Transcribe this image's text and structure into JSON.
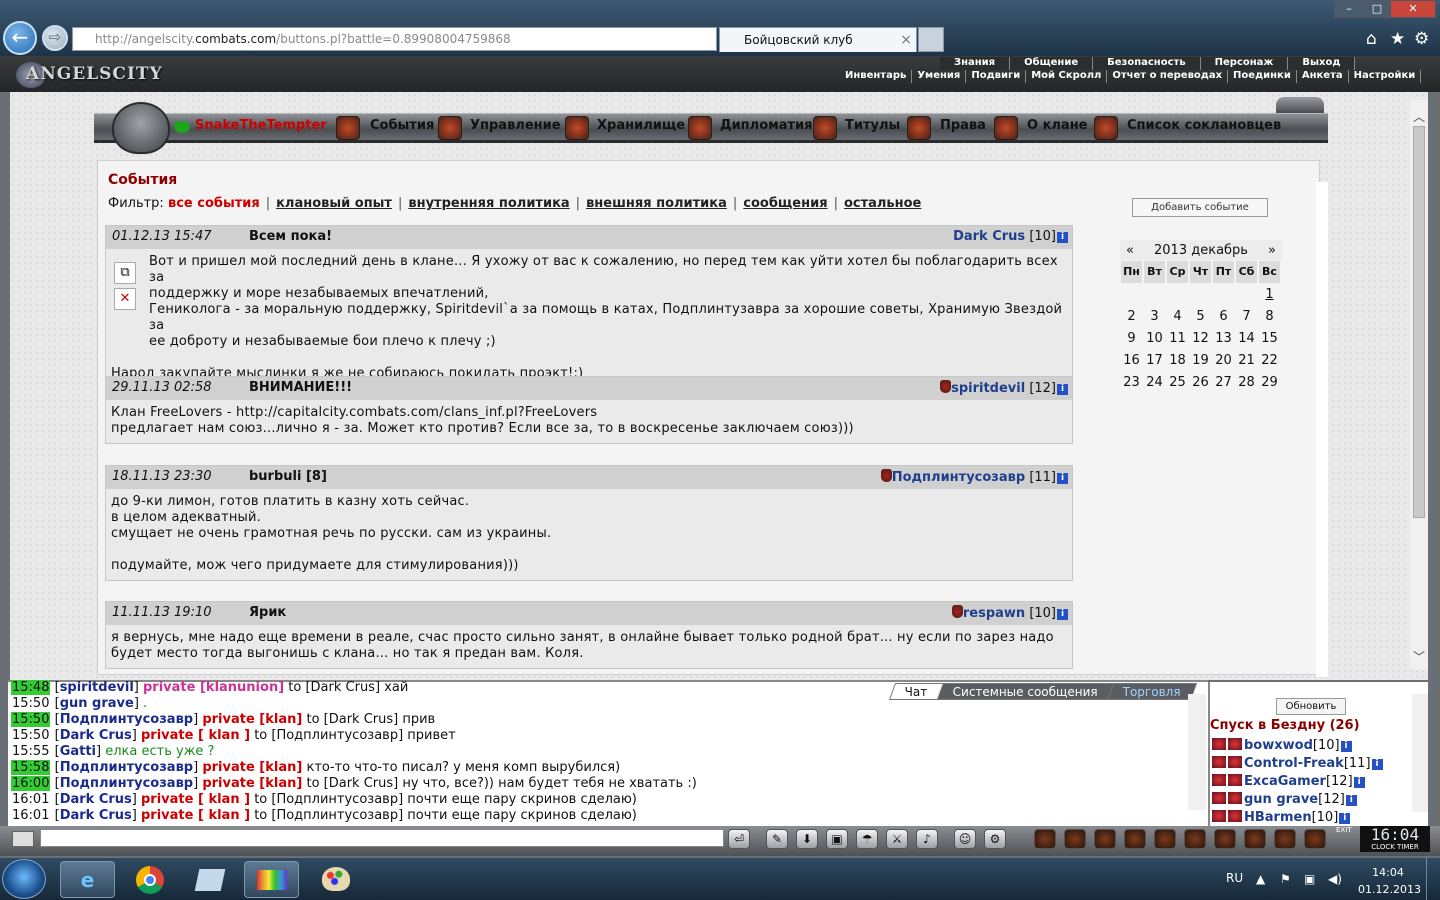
{
  "browser": {
    "url_prefix": "http://angelscity.",
    "url_domain": "combats.com",
    "url_suffix": "/buttons.pl?battle=0.89908004759868",
    "tab_title": "Бойцовский клуб",
    "tab_close": "×",
    "back_glyph": "←",
    "forward_glyph": "⇨",
    "win_min": "–",
    "win_max": "□",
    "win_close": "✕",
    "home_icon": "⌂",
    "star_icon": "★",
    "gear_icon": "⚙"
  },
  "header": {
    "logo": "ANGELSCITY",
    "menu_top": [
      "Знания",
      "Общение",
      "Безопасность",
      "Персонаж",
      "Выход"
    ],
    "menu_bottom": [
      "Инвентарь",
      "Умения",
      "Подвиги",
      "Мой Скролл",
      "Отчет о переводах",
      "Поединки",
      "Анкета",
      "Настройки"
    ]
  },
  "clan_toolbar": {
    "user": "SnakeTheTempter",
    "items": [
      "События",
      "Управление",
      "Хранилище",
      "Дипломатия",
      "Титулы",
      "Права",
      "О клане",
      "Список соклановцев"
    ]
  },
  "main": {
    "title": "События",
    "filter_label": "Фильтр:",
    "filters": [
      "все события",
      "клановый опыт",
      "внутренняя политика",
      "внешняя политика",
      "сообщения",
      "остальное"
    ],
    "add_event": "Добавить событие",
    "events": [
      {
        "date": "01.12.13 15:47",
        "title": "Всем пока!",
        "author": "Dark Crus",
        "level": "[10]",
        "lines": [
          "Вот и пришел мой последний день в клане... Я ухожу от вас к сожалению, но перед тем как уйти хотел бы поблагодарить всех за",
          "поддержку и море незабываемых впечатлений,",
          "Гениколога - за моральную поддержку, Spiritdevil`а за помощь в катах, Подплинтузавра за хорошие советы, Хранимую Звездой за",
          "ее доброту и незабываемые бои плечо к плечу ;)",
          "",
          "Народ закупайте мыслинки я же не собираюсь покидать проэкт!:)"
        ]
      },
      {
        "date": "29.11.13 02:58",
        "title": "ВНИМАНИЕ!!!",
        "author": "spiritdevil",
        "level": "[12]",
        "lines": [
          "Клан FreeLovers - http://capitalcity.combats.com/clans_inf.pl?FreeLovers",
          "предлагает нам союз...лично я - за. Может кто против? Если все за, то в воскресенье заключаем союз)))"
        ]
      },
      {
        "date": "18.11.13 23:30",
        "title": "burbuli [8]",
        "author": "Подплинтусозавр",
        "level": "[11]",
        "lines": [
          "до 9-ки лимон, готов платить в казну хоть сейчас.",
          "в целом адекватный.",
          "смущает не очень грамотная речь по русски. сам из украины.",
          "",
          "подумайте, мож чего придумаете для стимулирования)))"
        ]
      },
      {
        "date": "11.11.13 19:10",
        "title": "Ярик",
        "author": "respawn",
        "level": "[10]",
        "lines": [
          "я вернусь, мне надо еще времени в реале, счас просто сильно занят, в онлайне бывает только родной брат... ну если по зарез надо",
          "будет место тогда выгонишь с клана... но так я предан вам. Коля."
        ]
      }
    ],
    "calendar": {
      "prev": "«",
      "next": "»",
      "month": "2013 декабрь",
      "weekdays": [
        "Пн",
        "Вт",
        "Ср",
        "Чт",
        "Пт",
        "Сб",
        "Вс"
      ],
      "weeks": [
        [
          "",
          "",
          "",
          "",
          "",
          "",
          "1"
        ],
        [
          "2",
          "3",
          "4",
          "5",
          "6",
          "7",
          "8"
        ],
        [
          "9",
          "10",
          "11",
          "12",
          "13",
          "14",
          "15"
        ],
        [
          "16",
          "17",
          "18",
          "19",
          "20",
          "21",
          "22"
        ],
        [
          "23",
          "24",
          "25",
          "26",
          "27",
          "28",
          "29"
        ]
      ]
    }
  },
  "chat": {
    "tabs": [
      "Чат",
      "Системные сообщения",
      "Торговля"
    ],
    "lines": [
      {
        "time": "15:48",
        "hl": true,
        "nick": "spiritdevil",
        "priv": "private [klanunion]",
        "pcls": "pv2",
        "to": "to [Dark Crus]",
        "msg": "хай"
      },
      {
        "time": "15:50",
        "hl": false,
        "nick": "gun grave",
        "priv": "",
        "pcls": "pv",
        "to": "",
        "msg": "."
      },
      {
        "time": "15:50",
        "hl": true,
        "nick": "Подплинтусозавр",
        "priv": "private [klan]",
        "pcls": "pv",
        "to": "to [Dark Crus]",
        "msg": "прив"
      },
      {
        "time": "15:50",
        "hl": false,
        "nick": "Dark Crus",
        "priv": "private [ klan ]",
        "pcls": "pv",
        "to": "to [Подплинтусозавр]",
        "msg": "привет"
      },
      {
        "time": "15:55",
        "hl": false,
        "nick": "Gatti",
        "priv": "",
        "pcls": "pv",
        "to": "",
        "msg": "елка есть уже ?"
      },
      {
        "time": "15:58",
        "hl": true,
        "nick": "Подплинтусозавр",
        "priv": "private [klan]",
        "pcls": "pv",
        "to": "",
        "msg": "кто-то что-то писал? у меня комп вырубился)"
      },
      {
        "time": "16:00",
        "hl": true,
        "nick": "Подплинтусозавр",
        "priv": "private [klan]",
        "pcls": "pv",
        "to": "to [Dark Crus]",
        "msg": "ну что, все?)) нам будет тебя не хватать :)"
      },
      {
        "time": "16:01",
        "hl": false,
        "nick": "Dark Crus",
        "priv": "private [ klan ]",
        "pcls": "pv",
        "to": "to [Подплинтусозавр]",
        "msg": "почти еще пару скринов сделаю)"
      },
      {
        "time": "16:01",
        "hl": false,
        "nick": "Dark Crus",
        "priv": "private [ klan ]",
        "pcls": "pv",
        "to": "to [Подплинтусозавр]",
        "msg": "почти еще пару скринов сделаю)"
      }
    ]
  },
  "online": {
    "refresh": "Обновить",
    "title": "Спуск в Бездну (26)",
    "users": [
      {
        "name": "bowxwod",
        "level": "[10]"
      },
      {
        "name": "Control-Freak",
        "level": "[11]"
      },
      {
        "name": "ExcaGamer",
        "level": "[12]"
      },
      {
        "name": "gun grave",
        "level": "[12]"
      },
      {
        "name": "HBarmen",
        "level": "[10]"
      }
    ]
  },
  "gamebar": {
    "clock": "16:04",
    "clock_labels": "CLOCK  TIMER",
    "exit": "EXIT"
  },
  "taskbar": {
    "lang": "RU",
    "time": "14:04",
    "date": "01.12.2013"
  }
}
